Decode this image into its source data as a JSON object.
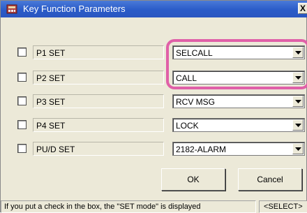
{
  "window": {
    "title": "Key Function Parameters",
    "close_label": "X"
  },
  "rows": [
    {
      "label": "P1 SET",
      "checked": false,
      "value": "SELCALL"
    },
    {
      "label": "P2 SET",
      "checked": false,
      "value": "CALL"
    },
    {
      "label": "P3 SET",
      "checked": false,
      "value": "RCV MSG"
    },
    {
      "label": "P4 SET",
      "checked": false,
      "value": "LOCK"
    },
    {
      "label": "PU/D SET",
      "checked": false,
      "value": "2182-ALARM"
    }
  ],
  "buttons": {
    "ok": "OK",
    "cancel": "Cancel"
  },
  "status": {
    "message": "If you put a check in the box, the \"SET mode\" is displayed",
    "mode": "<SELECT>"
  },
  "colors": {
    "highlight": "#e060a8",
    "titlebar": "#2a5bc8"
  }
}
